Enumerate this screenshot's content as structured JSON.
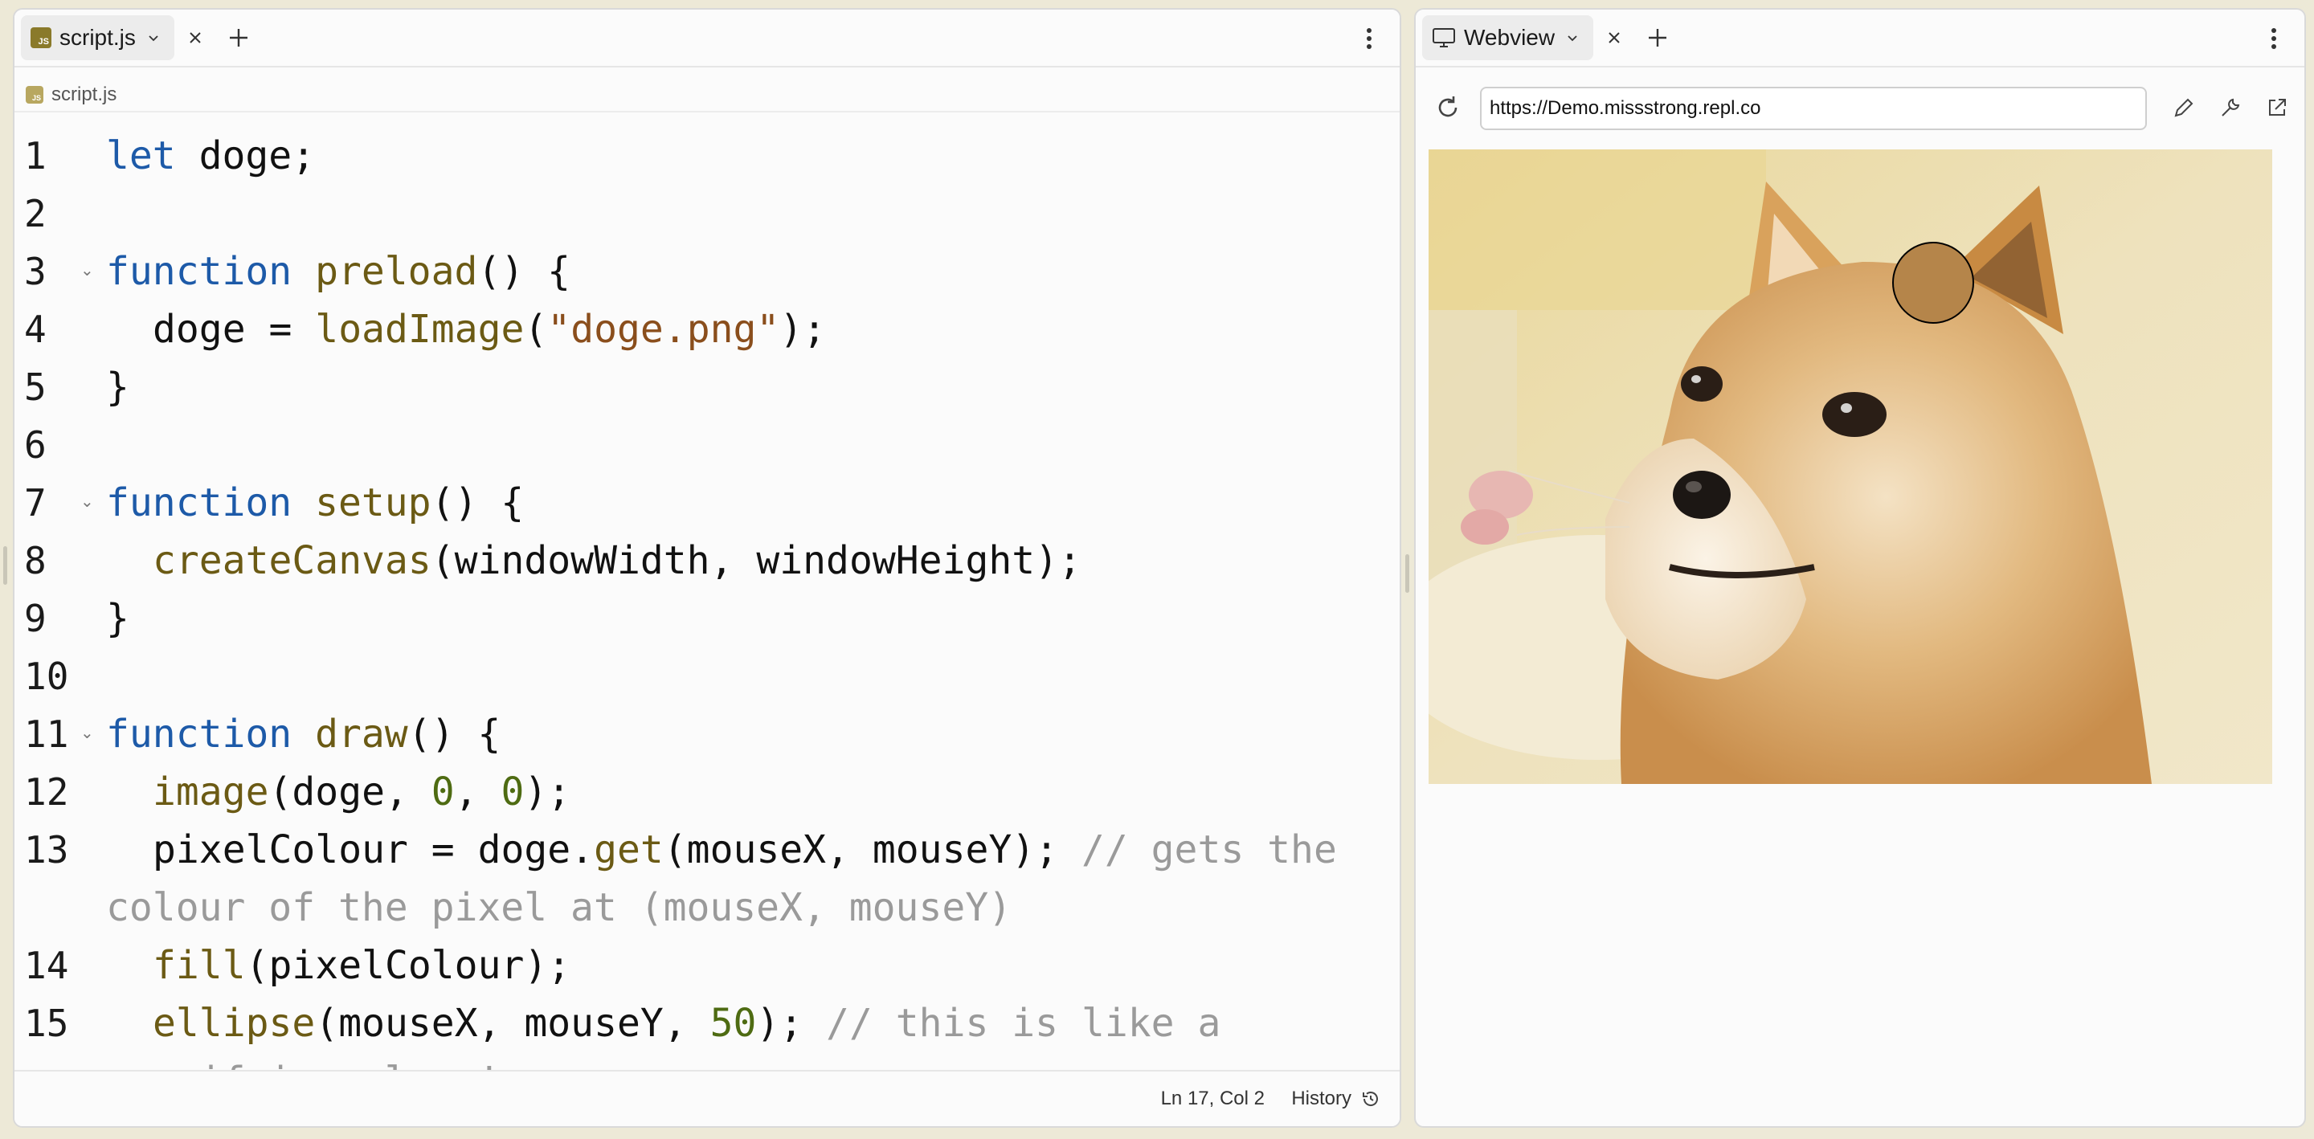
{
  "editor": {
    "tab_label": "script.js",
    "breadcrumb_label": "script.js",
    "file_badge": "JS",
    "lines": [
      {
        "n": "1"
      },
      {
        "n": "2"
      },
      {
        "n": "3"
      },
      {
        "n": "4"
      },
      {
        "n": "5"
      },
      {
        "n": "6"
      },
      {
        "n": "7"
      },
      {
        "n": "8"
      },
      {
        "n": "9"
      },
      {
        "n": "10"
      },
      {
        "n": "11"
      },
      {
        "n": "12"
      },
      {
        "n": "13"
      },
      {
        "n": "14"
      },
      {
        "n": "15"
      }
    ],
    "code": {
      "l1_kw": "let",
      "l1_rest": " doge;",
      "l3_kw": "function",
      "l3_fn": " preload",
      "l3_rest": "() {",
      "l4_a": "doge = ",
      "l4_fn": "loadImage",
      "l4_b": "(",
      "l4_str": "\"doge.png\"",
      "l4_c": ");",
      "l5": "}",
      "l7_kw": "function",
      "l7_fn": " setup",
      "l7_rest": "() {",
      "l8_fn": "createCanvas",
      "l8_rest": "(windowWidth, windowHeight);",
      "l9": "}",
      "l11_kw": "function",
      "l11_fn": " draw",
      "l11_rest": "() {",
      "l12_fn": "image",
      "l12_a": "(doge, ",
      "l12_n1": "0",
      "l12_b": ", ",
      "l12_n2": "0",
      "l12_c": ");",
      "l13_a": "pixelColour = doge.",
      "l13_fn": "get",
      "l13_b": "(mouseX, mouseY); ",
      "l13_cmt": "// gets the",
      "l13_cmt2": "colour of the pixel at (mouseX, mouseY)",
      "l14_fn": "fill",
      "l14_rest": "(pixelColour);",
      "l15_fn": "ellipse",
      "l15_a": "(mouseX, mouseY, ",
      "l15_n": "50",
      "l15_b": "); ",
      "l15_cmt": "// this is like a",
      "l15_cmt2": "magnifying glass!"
    },
    "status_position": "Ln 17, Col 2",
    "status_history": "History"
  },
  "webview": {
    "tab_label": "Webview",
    "url": "https://Demo.missstrong.repl.co",
    "canvas_image": "doge-photo",
    "ellipse_color": "#b5854a"
  },
  "colors": {
    "keyword": "#1d5aa8",
    "function": "#6b5a14",
    "string": "#8a4e1c",
    "number": "#4e6b12",
    "comment": "#9a9a9a",
    "background": "#ede9d7"
  }
}
